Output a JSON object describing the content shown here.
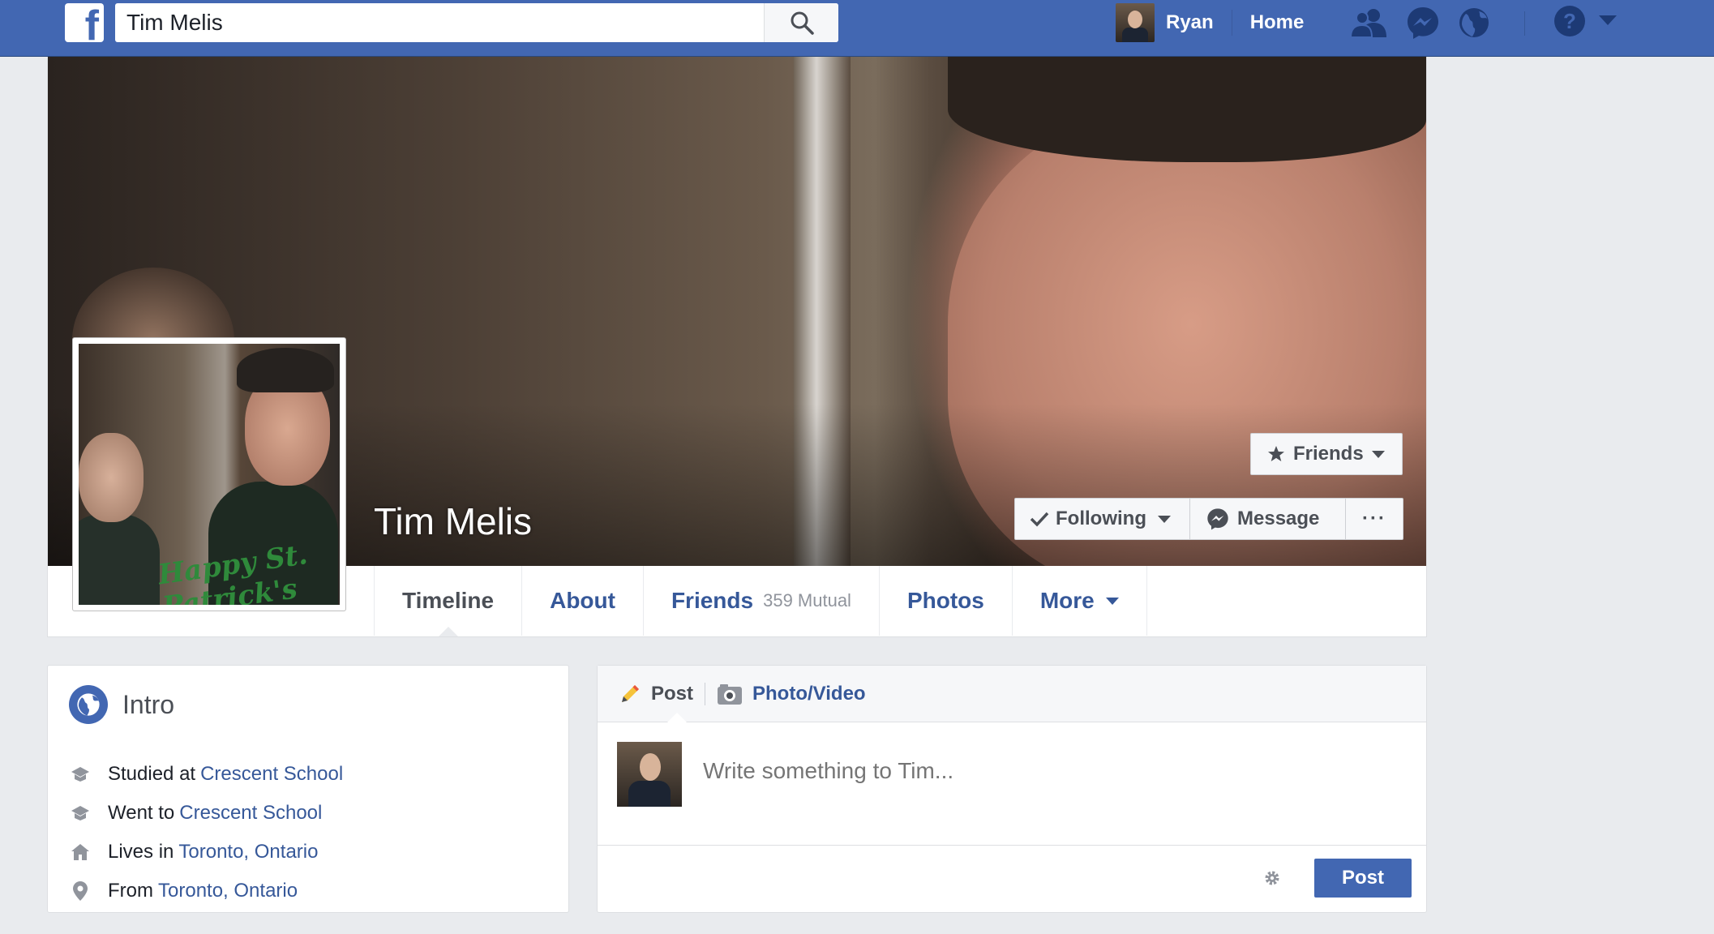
{
  "topbar": {
    "search_value": "Tim Melis",
    "user_name": "Ryan",
    "home_label": "Home"
  },
  "profile": {
    "name": "Tim Melis",
    "cover_text": "Happy St. Patrick's",
    "buttons": {
      "friends": "Friends",
      "following": "Following",
      "message": "Message",
      "more": "···"
    },
    "tabs": [
      {
        "label": "Timeline"
      },
      {
        "label": "About"
      },
      {
        "label": "Friends",
        "count": "359 Mutual"
      },
      {
        "label": "Photos"
      },
      {
        "label": "More"
      }
    ]
  },
  "intro": {
    "title": "Intro",
    "items": [
      {
        "icon": "school-icon",
        "prefix": "Studied at",
        "link": "Crescent School"
      },
      {
        "icon": "school-icon",
        "prefix": "Went to",
        "link": "Crescent School"
      },
      {
        "icon": "home-icon",
        "prefix": "Lives in",
        "link": "Toronto, Ontario"
      },
      {
        "icon": "location-pin-icon",
        "prefix": "From",
        "link": "Toronto, Ontario"
      }
    ]
  },
  "composer": {
    "tab_post": "Post",
    "tab_photo": "Photo/Video",
    "placeholder": "Write something to Tim...",
    "post_button": "Post"
  },
  "colors": {
    "brand_blue": "#4267b2",
    "link_blue": "#365899",
    "page_bg": "#e9ebee"
  }
}
